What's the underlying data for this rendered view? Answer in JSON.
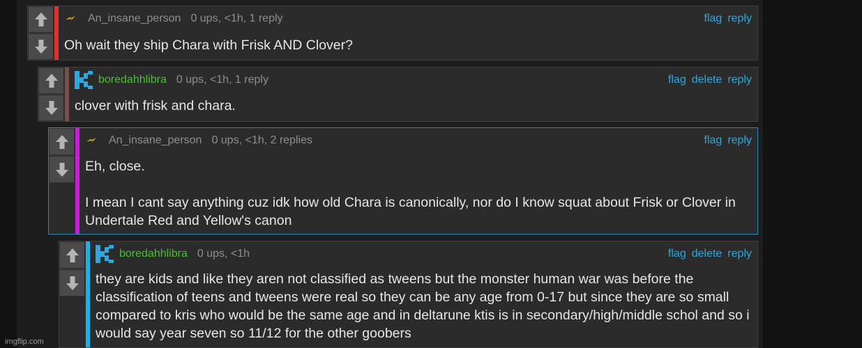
{
  "comments": [
    {
      "username": "An_insane_person",
      "meta": "0 ups, <1h, 1 reply",
      "actions": [
        "flag",
        "reply"
      ],
      "body": [
        "Oh wait they ship Chara with Frisk AND Clover?"
      ],
      "bar_color": "#e0302b"
    },
    {
      "username": "boredahhlibra",
      "meta": "0 ups, <1h, 1 reply",
      "actions": [
        "flag",
        "delete",
        "reply"
      ],
      "body": [
        "clover with frisk and chara."
      ],
      "bar_color": "#7a4f46"
    },
    {
      "username": "An_insane_person",
      "meta": "0 ups, <1h, 2 replies",
      "actions": [
        "flag",
        "reply"
      ],
      "body": [
        "Eh, close.",
        "I mean I cant say anything cuz idk how old Chara is canonically, nor do I know squat about Frisk or Clover in Undertale Red and Yellow's canon"
      ],
      "bar_color": "#c51ed6"
    },
    {
      "username": "boredahhlibra",
      "meta": "0 ups, <1h",
      "actions": [
        "flag",
        "delete",
        "reply"
      ],
      "body": [
        "they are kids and like they aren not classified as tweens but the monster human war was before the classification of teens and tweens were real so they can be any age from 0-17 but since they are so small compared to kris who would be the same age and in deltarune ktis is in secondary/high/middle schol and so i would say year seven so 11/12 for the other goobers"
      ],
      "bar_color": "#17b4ea"
    }
  ],
  "watermark": "imgflip.com",
  "colors": {
    "link": "#2aa9e0",
    "username_green": "#4cbf34",
    "highlight_border": "#1e8fb8"
  },
  "icons": {
    "upvote": "arrow-up-icon",
    "downvote": "arrow-down-icon",
    "avatar_a": "lightning-icon",
    "avatar_b": "pixel-avatar-icon"
  }
}
